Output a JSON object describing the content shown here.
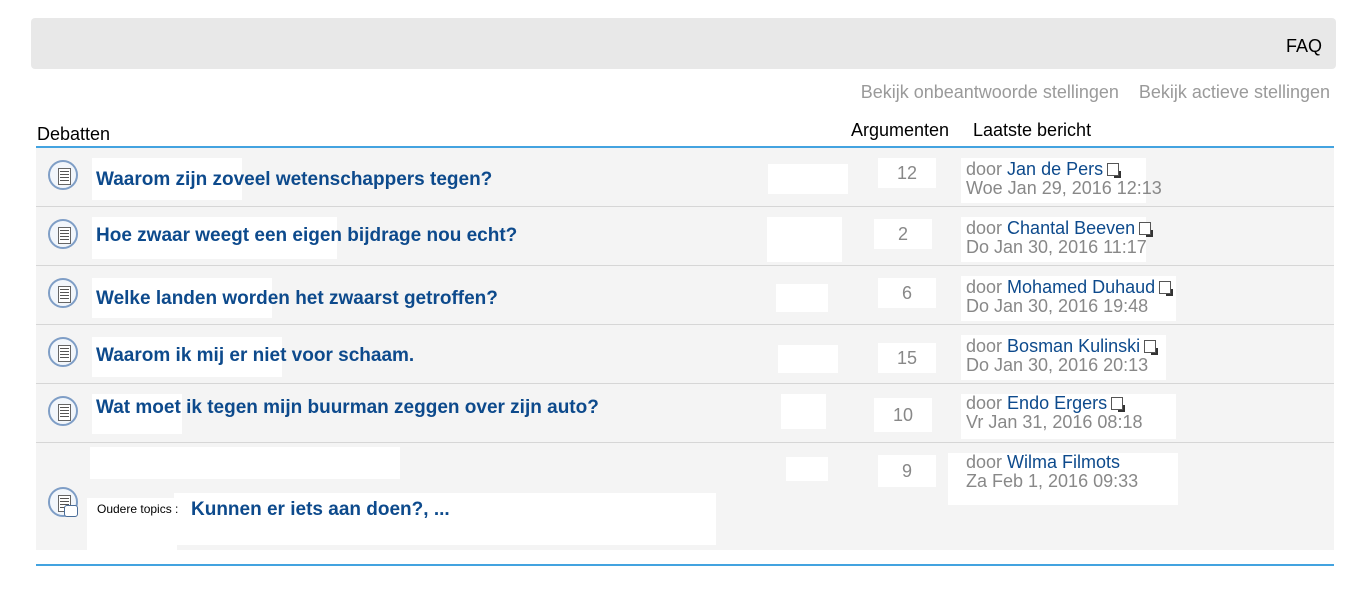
{
  "nav": {
    "faq": "FAQ"
  },
  "quicklinks": {
    "unanswered": "Bekijk onbeantwoorde stellingen",
    "active": "Bekijk actieve stellingen"
  },
  "table_headers": {
    "topics": "Debatten",
    "replies": "Argumenten",
    "last_post": "Laatste bericht"
  },
  "topics": [
    {
      "title": "Waarom zijn zoveel wetenschappers tegen?",
      "replies": "12",
      "by": "door",
      "author": "Jan de Pers",
      "date": "Woe Jan 29, 2016 12:13"
    },
    {
      "title": "Hoe zwaar weegt een eigen bijdrage nou echt?",
      "replies": "2",
      "by": "door",
      "author": "Chantal Beeven",
      "date": "Do Jan 30, 2016 11:17"
    },
    {
      "title": "Welke landen worden het zwaarst getroffen?",
      "replies": "6",
      "by": "door",
      "author": "Mohamed Duhaud",
      "date": "Do Jan 30, 2016 19:48"
    },
    {
      "title": "Waarom ik mij er niet voor schaam.",
      "replies": "15",
      "by": "door",
      "author": "Bosman Kulinski",
      "date": "Do Jan 30, 2016 20:13"
    },
    {
      "title": "Wat moet ik tegen mijn buurman zeggen over zijn auto?",
      "replies": "10",
      "by": "door",
      "author": "Endo Ergers",
      "date": "Vr Jan 31, 2016 08:18"
    },
    {
      "older_label": "Oudere topics :",
      "title": "Kunnen er iets aan doen?, ...",
      "replies": "9",
      "by": "door",
      "author": "Wilma Filmots",
      "date": "Za Feb 1, 2016 09:33"
    }
  ]
}
